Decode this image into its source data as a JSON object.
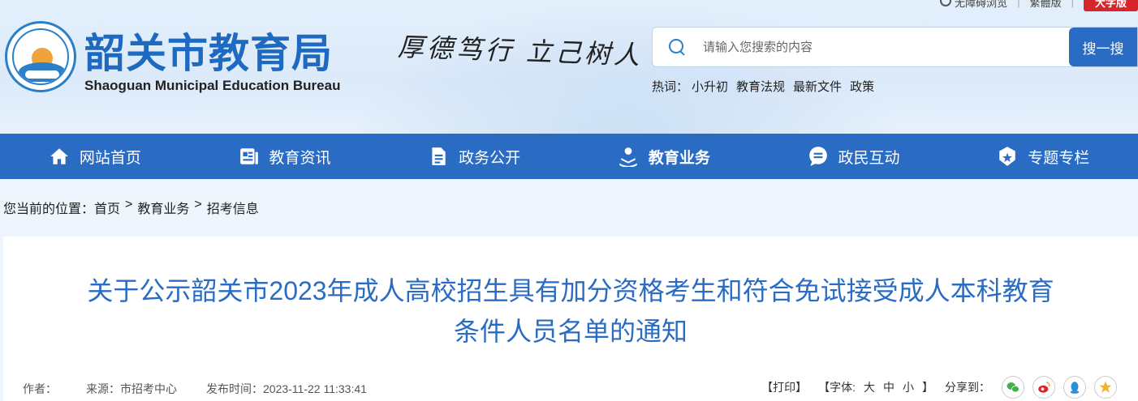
{
  "topbar": {
    "accessibility": "无障碍浏览",
    "simplified": "繁體版",
    "elder_version": "大字版"
  },
  "site": {
    "title_cn": "韶关市教育局",
    "title_en": "Shaoguan Municipal Education Bureau",
    "slogan": "厚德笃行 立己树人"
  },
  "search": {
    "placeholder": "请输入您搜索的内容",
    "button": "搜一搜",
    "hot_label": "热词：",
    "hot_words": [
      "小升初",
      "教育法规",
      "最新文件",
      "政策"
    ]
  },
  "nav": {
    "items": [
      {
        "label": "网站首页",
        "icon": "home-icon"
      },
      {
        "label": "教育资讯",
        "icon": "news-icon"
      },
      {
        "label": "政务公开",
        "icon": "document-icon"
      },
      {
        "label": "教育业务",
        "icon": "education-icon",
        "active": true
      },
      {
        "label": "政民互动",
        "icon": "chat-icon"
      },
      {
        "label": "专题专栏",
        "icon": "badge-icon"
      }
    ]
  },
  "breadcrumb": {
    "prefix": "您当前的位置：",
    "items": [
      "首页",
      "教育业务",
      "招考信息"
    ],
    "separator": ">"
  },
  "article": {
    "title_line1": "关于公示韶关市2023年成人高校招生具有加分资格考生和符合免试接受成人本科教育",
    "title_line2": "条件人员名单的通知",
    "author_label": "作者：",
    "source_label": "来源：",
    "source": "市招考中心",
    "date_label": "发布时间：",
    "date": "2023-11-22 11:33:41",
    "print": "【打印】",
    "font_label": "【字体:",
    "font_big": "大",
    "font_mid": "中",
    "font_small": "小",
    "font_end": "】",
    "share_label": "分享到："
  },
  "colors": {
    "brand_blue": "#2a6cc4",
    "title_blue": "#1d6ac0",
    "elder_red": "#d6252b"
  }
}
